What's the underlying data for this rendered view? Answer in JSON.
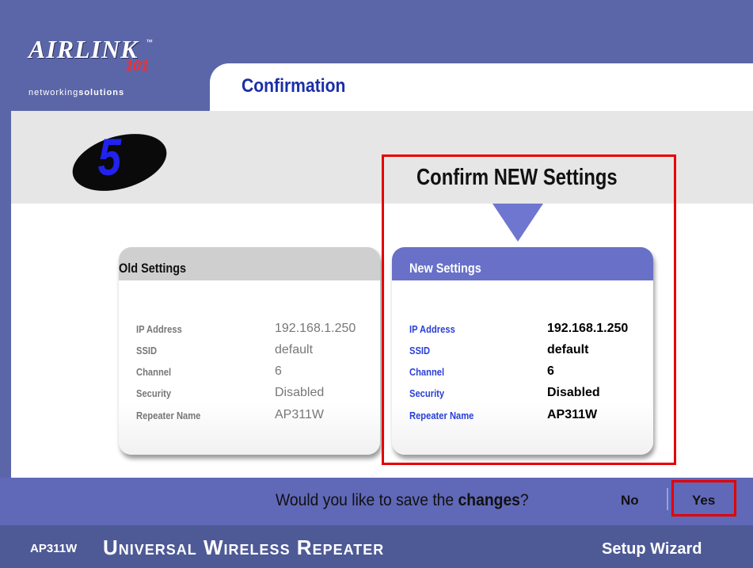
{
  "brand": {
    "logo_text": "AIRLINK",
    "logo_tm": "™",
    "logo_number": "101",
    "tagline_prefix": "networking",
    "tagline_suffix": "solutions"
  },
  "page": {
    "title": "Confirmation",
    "step_number": "5",
    "confirm_heading": "Confirm NEW Settings"
  },
  "old_settings": {
    "title": "Old Settings",
    "rows": [
      {
        "label": "IP Address",
        "value": "192.168.1.250"
      },
      {
        "label": "SSID",
        "value": "default"
      },
      {
        "label": "Channel",
        "value": "6"
      },
      {
        "label": "Security",
        "value": "Disabled"
      },
      {
        "label": "Repeater Name",
        "value": "AP311W"
      }
    ]
  },
  "new_settings": {
    "title": "New Settings",
    "rows": [
      {
        "label": "IP Address",
        "value": "192.168.1.250"
      },
      {
        "label": "SSID",
        "value": "default"
      },
      {
        "label": "Channel",
        "value": "6"
      },
      {
        "label": "Security",
        "value": "Disabled"
      },
      {
        "label": "Repeater Name",
        "value": "AP311W"
      }
    ]
  },
  "prompt": {
    "question_start": "Would you like to save the ",
    "question_emphasis": "changes",
    "question_end": "?",
    "no_label": "No",
    "yes_label": "Yes"
  },
  "footer": {
    "model": "AP311W",
    "product": "Universal Wireless Repeater",
    "wizard": "Setup Wizard"
  },
  "colors": {
    "header": "#5a66a8",
    "accent": "#6870c8",
    "highlight": "#e60000",
    "title_blue": "#1a2fa8"
  }
}
